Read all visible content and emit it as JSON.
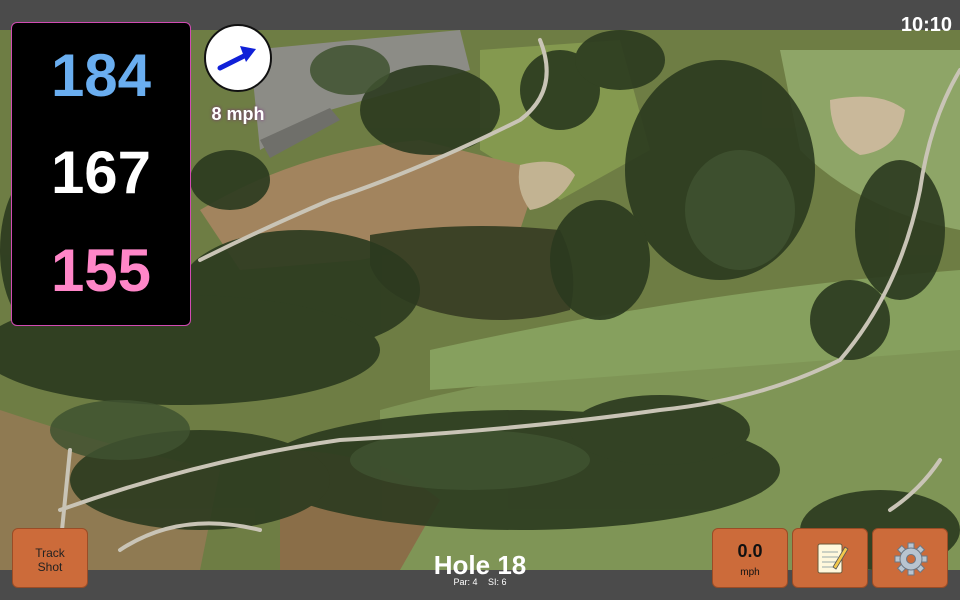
{
  "status": {
    "time": "10:10"
  },
  "distances": {
    "back": "184",
    "middle": "167",
    "front": "155"
  },
  "wind": {
    "speed": "8 mph"
  },
  "actions": {
    "track_shot": [
      "Track",
      "Shot"
    ],
    "ball_speed_value": "0.0",
    "ball_speed_unit": "mph"
  },
  "hole": {
    "title": "Hole 18",
    "par": "Par: 4",
    "si": "SI: 6"
  },
  "colors": {
    "accent": "#cc6b3a",
    "back_distance": "#6aaef0",
    "middle_distance": "#ffffff",
    "front_distance": "#ff86c8",
    "panel_border": "#d14bb3",
    "wind_arrow": "#1020d8"
  },
  "icons": {
    "wind": "arrow-icon",
    "notes": "notepad-icon",
    "settings": "gear-icon"
  }
}
